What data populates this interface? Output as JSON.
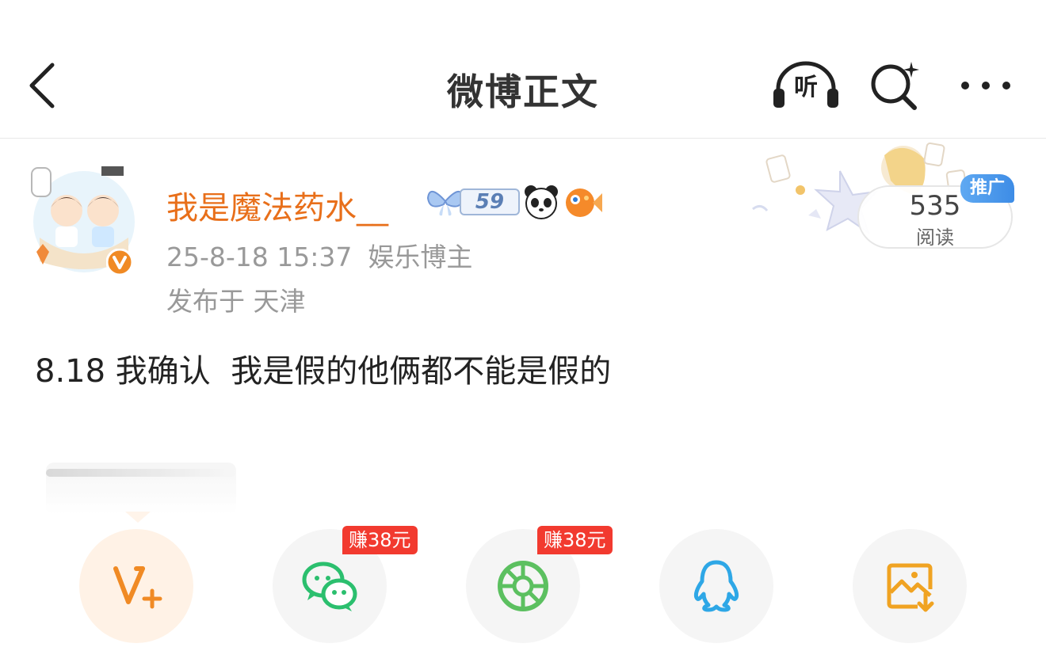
{
  "header": {
    "title": "微博正文",
    "listen_label": "听"
  },
  "post": {
    "author": {
      "name": "我是魔法药水__",
      "level_badge": "59"
    },
    "timestamp": "25-8-18 15:37",
    "role": "娱乐博主",
    "location": "发布于 天津",
    "text": "8.18 我确认  我是假的他俩都不能是假的",
    "read_count": "535",
    "read_label": "阅读",
    "promo_tag": "推广"
  },
  "share": {
    "items": [
      {
        "name": "vplus",
        "icon": "v-plus-icon",
        "color": "#f08a24"
      },
      {
        "name": "wechat",
        "icon": "wechat-icon",
        "color": "#2bbf6e",
        "earn": "赚38元"
      },
      {
        "name": "moments",
        "icon": "moments-icon",
        "color": "#5cc060",
        "earn": "赚38元"
      },
      {
        "name": "qq",
        "icon": "qq-icon",
        "color": "#2ea7e6"
      },
      {
        "name": "save-image",
        "icon": "save-image-icon",
        "color": "#f0a322"
      }
    ]
  },
  "colors": {
    "username": "#e86f1a",
    "earn_badge": "#f23a2f",
    "promo_tag": "#3d8ce6"
  }
}
